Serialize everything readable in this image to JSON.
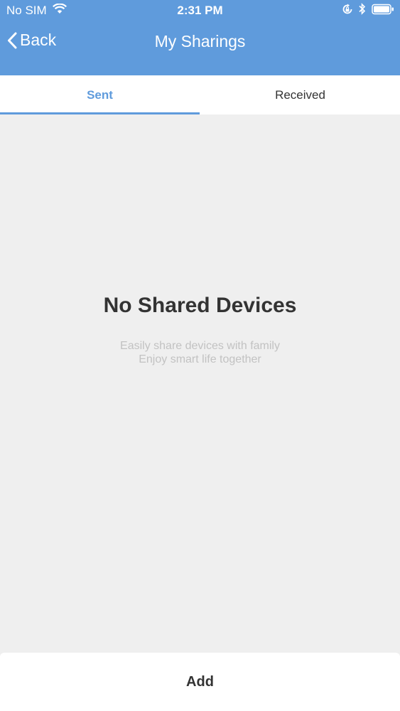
{
  "status_bar": {
    "carrier": "No SIM",
    "time": "2:31 PM",
    "icons": [
      "wifi-icon",
      "rotation-lock-icon",
      "bluetooth-icon",
      "battery-icon"
    ]
  },
  "nav": {
    "back_label": "Back",
    "title": "My Sharings"
  },
  "tabs": [
    {
      "label": "Sent",
      "active": true
    },
    {
      "label": "Received",
      "active": false
    }
  ],
  "empty_state": {
    "title": "No Shared Devices",
    "line1": "Easily share devices with family",
    "line2": "Enjoy smart life together"
  },
  "footer": {
    "add_label": "Add"
  },
  "colors": {
    "header": "#5f9bdc",
    "accent": "#5f9bdc",
    "background": "#efefef"
  }
}
